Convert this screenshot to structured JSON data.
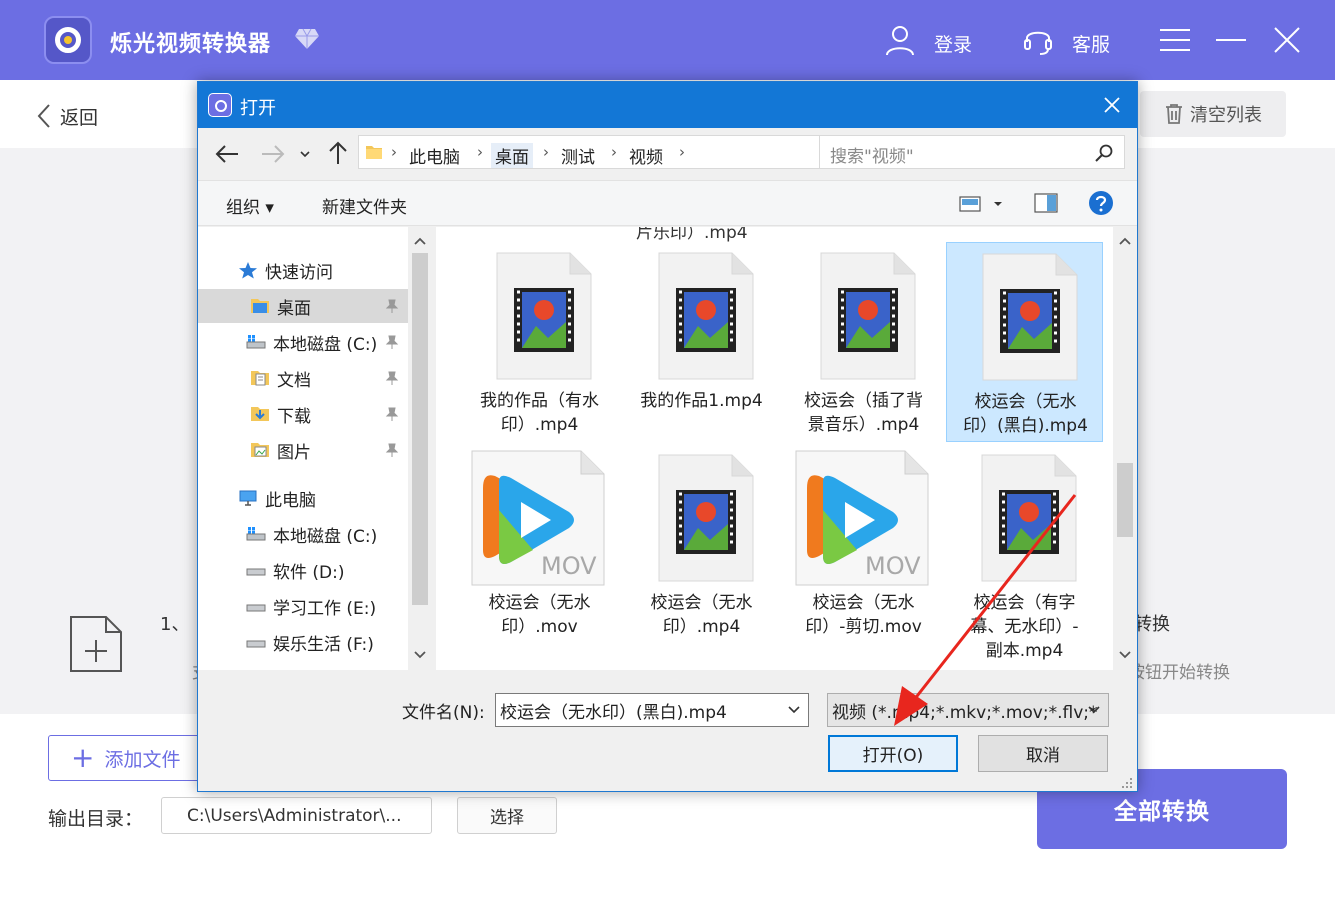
{
  "app": {
    "title": "烁光视频转换器",
    "login_label": "登录",
    "service_label": "客服",
    "accent": "#6c6ee3"
  },
  "header": {
    "back_label": "返回",
    "clear_label": "清空列表"
  },
  "main": {
    "hint_line1_left": "1、",
    "hint_line1_right": "转换",
    "hint_line2_left": "支",
    "hint_line2_right": "按钮开始转换"
  },
  "bottom": {
    "add_file_label": "添加文件",
    "output_label": "输出目录：",
    "output_path": "C:\\Users\\Administrator\\...",
    "choose_label": "选择",
    "convert_all_label": "全部转换"
  },
  "dialog": {
    "title": "打开",
    "breadcrumbs": [
      "此电脑",
      "桌面",
      "测试",
      "视频"
    ],
    "search_placeholder": "搜索\"视频\"",
    "organize_label": "组织 ▾",
    "new_folder_label": "新建文件夹",
    "nav": {
      "quick_access": "快速访问",
      "desktop": "桌面",
      "local_c": "本地磁盘 (C:)",
      "documents": "文档",
      "downloads": "下载",
      "pictures": "图片",
      "this_pc": "此电脑",
      "local_c2": "本地磁盘 (C:)",
      "soft_d": "软件 (D:)",
      "study_e": "学习工作 (E:)",
      "fun_f": "娱乐生活 (F:)"
    },
    "top_cut_text": "片乐印）.mp4",
    "files": [
      {
        "line1": "我的作品（有水",
        "line2": "印）.mp4",
        "line3": "",
        "type": "video"
      },
      {
        "line1": "我的作品1.mp4",
        "line2": "",
        "line3": "",
        "type": "video"
      },
      {
        "line1": "校运会（插了背",
        "line2": "景音乐）.mp4",
        "line3": "",
        "type": "video"
      },
      {
        "line1": "校运会（无水",
        "line2": "印）(黑白).mp4",
        "line3": "",
        "type": "video"
      },
      {
        "line1": "校运会（无水",
        "line2": "印）.mov",
        "line3": "",
        "type": "mov"
      },
      {
        "line1": "校运会（无水",
        "line2": "印）.mp4",
        "line3": "",
        "type": "video"
      },
      {
        "line1": "校运会（无水",
        "line2": "印）-剪切.mov",
        "line3": "",
        "type": "mov"
      },
      {
        "line1": "校运会（有字",
        "line2": "幕、无水印）-",
        "line3": "副本.mp4",
        "type": "video"
      }
    ],
    "mov_badge": "MOV",
    "filename_label": "文件名(N):",
    "filename_value": "校运会（无水印）(黑白).mp4",
    "filetype_value": "视频 (*.mp4;*.mkv;*.mov;*.flv;*",
    "open_label": "打开(O)",
    "cancel_label": "取消"
  }
}
